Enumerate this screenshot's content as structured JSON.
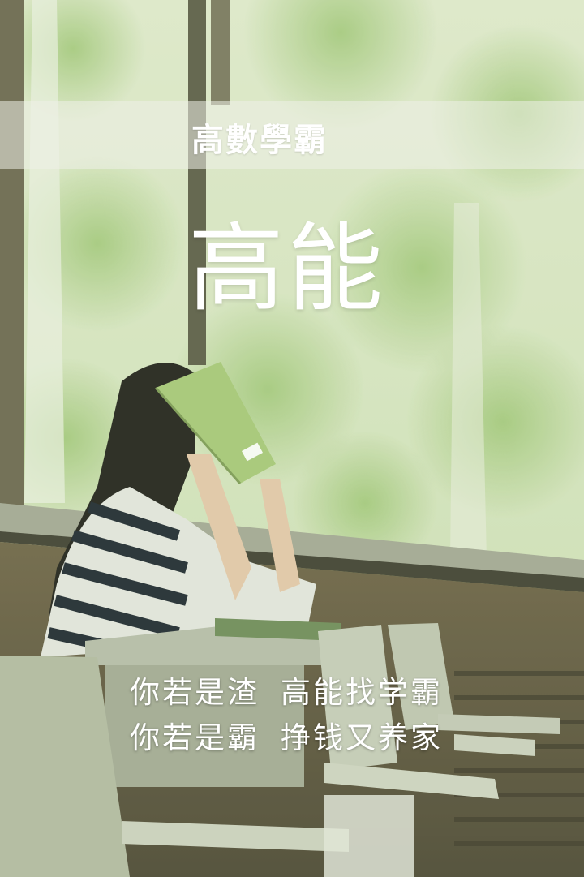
{
  "poster": {
    "banner_title": "高數學霸",
    "headline": "高能",
    "slogan": {
      "line1_left": "你若是渣",
      "line1_right": "高能找学霸",
      "line2_left": "你若是霸",
      "line2_right": "挣钱又养家"
    }
  },
  "colors": {
    "foliage": "#c8dcaa",
    "window_frame": "#5c5a48",
    "desk": "#c9cdbd",
    "text": "#ffffff"
  }
}
